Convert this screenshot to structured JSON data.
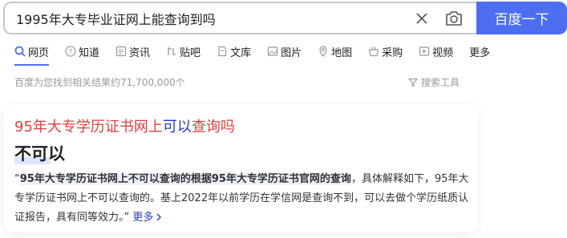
{
  "search": {
    "query": "1995年大专毕业证网上能查询到吗",
    "button_label": "百度一下"
  },
  "tabs": [
    {
      "label": "网页",
      "icon": "search-icon",
      "active": true
    },
    {
      "label": "知道",
      "icon": "question-icon"
    },
    {
      "label": "资讯",
      "icon": "news-icon"
    },
    {
      "label": "贴吧",
      "icon": "tieba-icon"
    },
    {
      "label": "文库",
      "icon": "document-icon"
    },
    {
      "label": "图片",
      "icon": "image-icon"
    },
    {
      "label": "地图",
      "icon": "map-pin-icon"
    },
    {
      "label": "采购",
      "icon": "shopping-basket-icon"
    },
    {
      "label": "视频",
      "icon": "video-icon"
    },
    {
      "label": "更多"
    }
  ],
  "results": {
    "count_text": "百度为您找到相关结果约71,700,000个",
    "tools_label": "搜索工具"
  },
  "card": {
    "title_part1": "95年大专学历证书网上",
    "title_part2": "可以",
    "title_part3": "查询吗",
    "answer": "不可以",
    "snippet_bold": "95年大专学历证书网上不可以查询的根据95年大专学历证书官网的查询",
    "snippet_rest": "，具体解释如下，95年大专学历证书网上不可以查询的。基上2022年以前学历在学信网是查询不到，可以去做个学历纸质认证报告，具有同等效力。”",
    "more_label": "更多"
  },
  "colors": {
    "accent": "#4e6ef2",
    "title_red": "#e13d3d",
    "link_blue": "#2440b3"
  }
}
